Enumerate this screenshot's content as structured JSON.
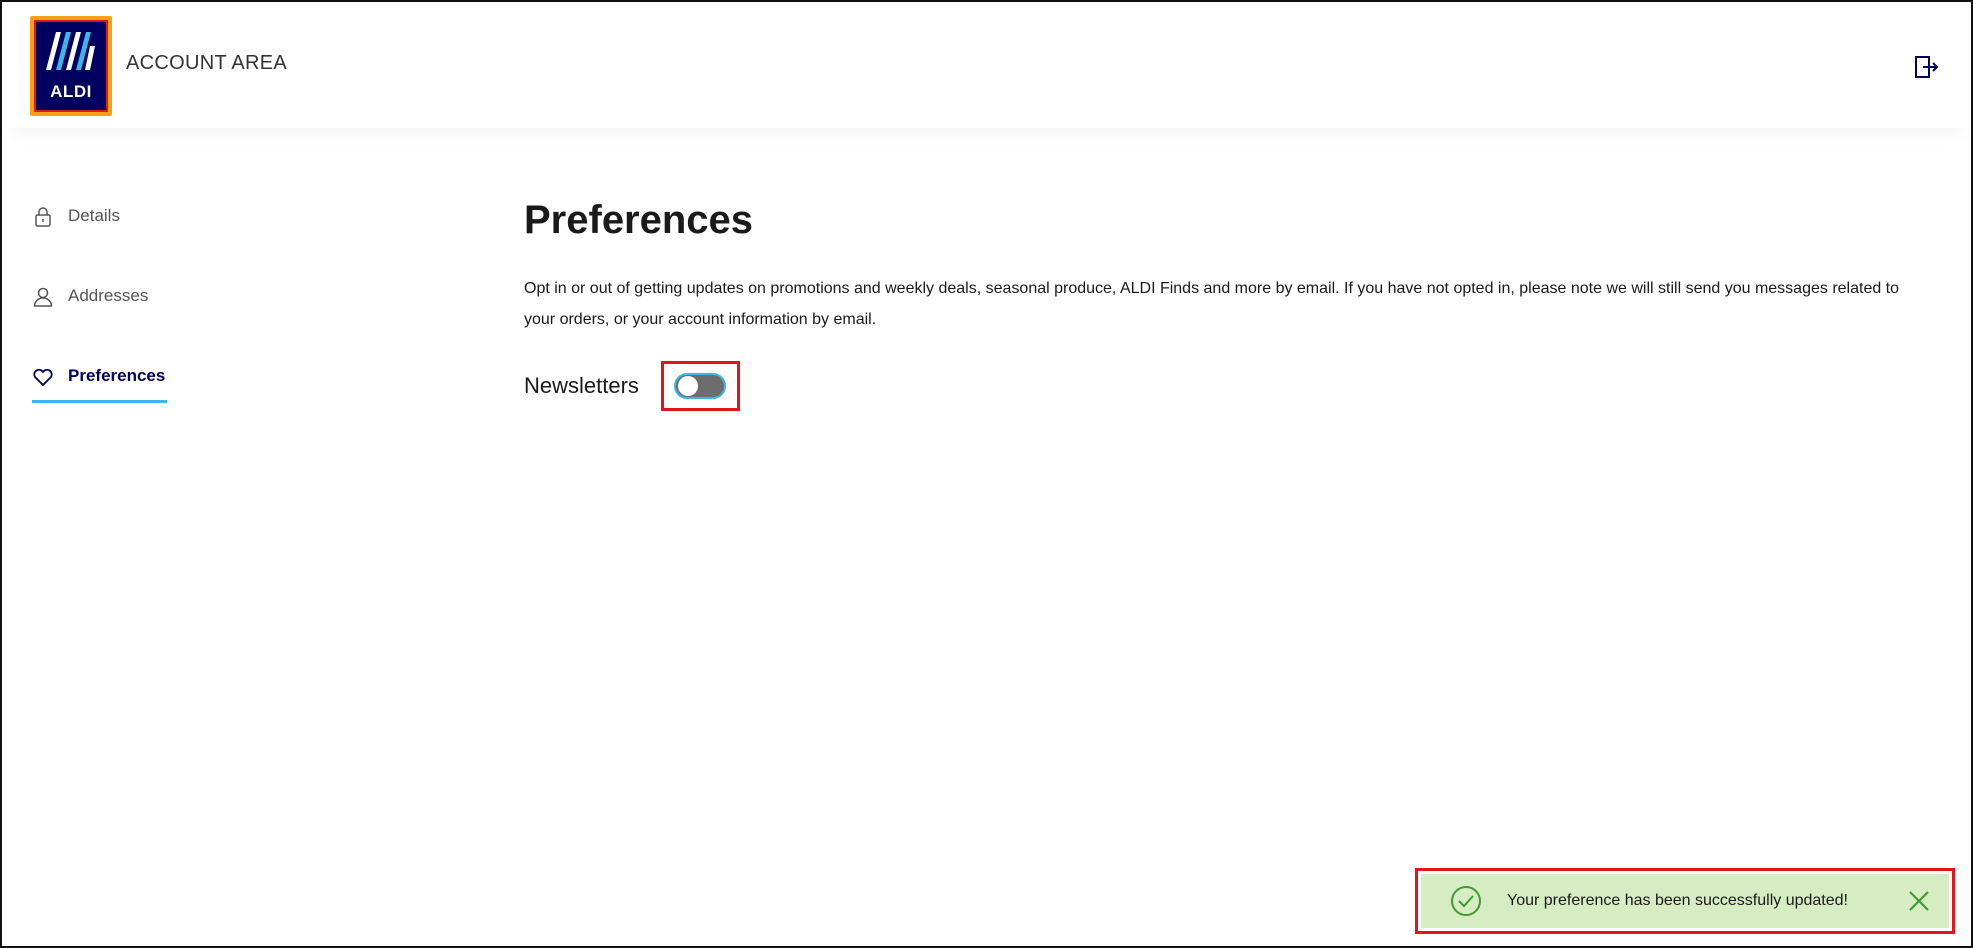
{
  "header": {
    "logo_text": "ALDI",
    "title": "ACCOUNT AREA",
    "logout_icon": "logout-icon"
  },
  "sidebar": {
    "items": [
      {
        "label": "Details",
        "icon": "lock-icon",
        "active": false
      },
      {
        "label": "Addresses",
        "icon": "user-icon",
        "active": false
      },
      {
        "label": "Preferences",
        "icon": "heart-icon",
        "active": true
      }
    ]
  },
  "main": {
    "title": "Preferences",
    "description": "Opt in or out of getting updates on promotions and weekly deals, seasonal produce, ALDI Finds and more by email. If you have not opted in, please note we will still send you messages related to your orders, or your account information by email.",
    "newsletters": {
      "label": "Newsletters",
      "enabled": false
    }
  },
  "toast": {
    "message": "Your preference has been successfully updated!",
    "icon": "check-circle-icon",
    "close_icon": "close-icon"
  },
  "colors": {
    "brand_navy": "#00005f",
    "brand_orange": "#f6a01a",
    "accent_blue": "#3ab7e8",
    "success_bg": "#d6ecc3",
    "success_green": "#3f9b2e",
    "highlight_red": "#e5141a"
  }
}
